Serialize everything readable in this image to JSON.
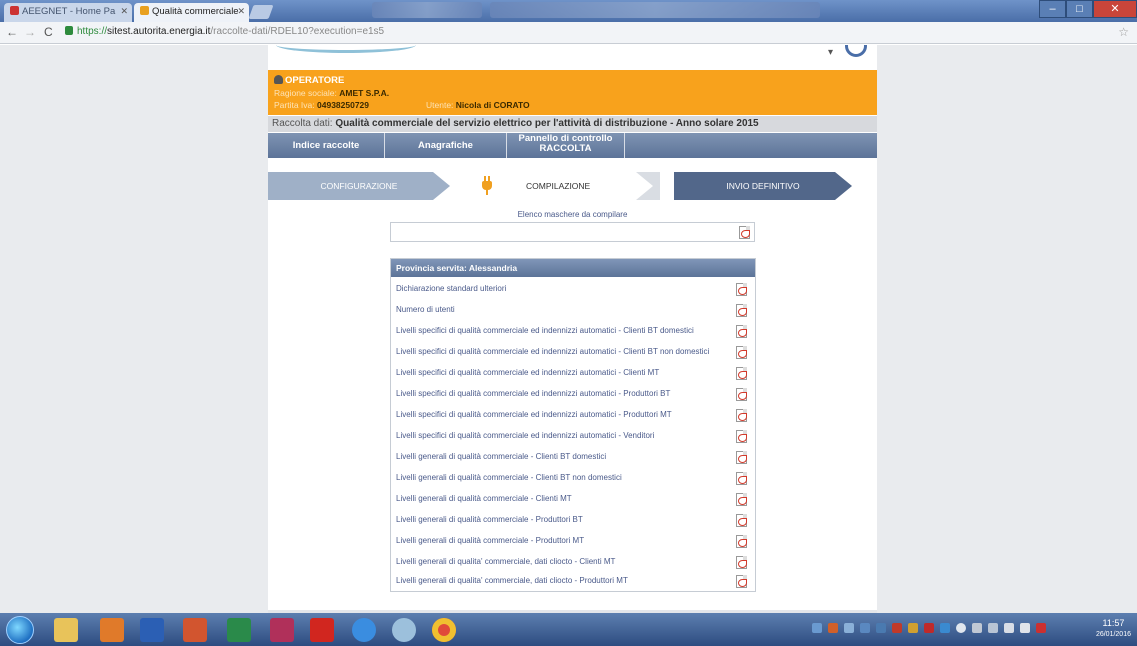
{
  "browser": {
    "tabs": [
      {
        "label": "AEEGNET - Home Pa",
        "active": false
      },
      {
        "label": "Qualità commerciale",
        "active": true
      }
    ],
    "url_scheme": "https://",
    "url_domain": "sitest.autorita.energia.it",
    "url_path": "/raccolte-dati/RDEL10?execution=e1s5"
  },
  "operator": {
    "heading": "OPERATORE",
    "ragione_label": "Ragione sociale:",
    "ragione_value": "AMET S.P.A.",
    "piva_label": "Partita Iva:",
    "piva_value": "04938250729",
    "utente_label": "Utente:",
    "utente_value": "Nicola di CORATO"
  },
  "raccolta": {
    "label": "Raccolta dati:",
    "value": "Qualità commerciale del servizio elettrico per l'attività di distribuzione - Anno solare 2015"
  },
  "nav": {
    "indice": "Indice raccolte",
    "anagrafiche": "Anagrafiche",
    "pannello_line1": "Pannello di controllo",
    "pannello_line2": "RACCOLTA"
  },
  "steps": {
    "configurazione": "CONFIGURAZIONE",
    "compilazione": "COMPILAZIONE",
    "invio": "INVIO DEFINITIVO"
  },
  "elenco_label": "Elenco maschere da compilare",
  "table": {
    "header": "Provincia servita: Alessandria",
    "rows": [
      "Dichiarazione standard ulteriori",
      "Numero di utenti",
      "Livelli specifici di qualità commerciale ed indennizzi automatici - Clienti BT domestici",
      "Livelli specifici di qualità commerciale ed indennizzi automatici - Clienti BT non domestici",
      "Livelli specifici di qualità commerciale ed indennizzi automatici - Clienti MT",
      "Livelli specifici di qualità commerciale ed indennizzi automatici - Produttori BT",
      "Livelli specifici di qualità commerciale ed indennizzi automatici - Produttori MT",
      "Livelli specifici di qualità commerciale ed indennizzi automatici - Venditori",
      "Livelli generali di qualità commerciale - Clienti BT domestici",
      "Livelli generali di qualità commerciale - Clienti BT non domestici",
      "Livelli generali di qualità commerciale - Clienti MT",
      "Livelli generali di qualità commerciale - Produttori BT",
      "Livelli generali di qualità commerciale - Produttori MT",
      "Livelli generali di qualita' commerciale, dati cliocto - Clienti MT",
      "Livelli generali di qualita' commerciale, dati cliocto - Produttori MT"
    ]
  },
  "clock": {
    "time": "11:57",
    "date": "26/01/2016"
  },
  "colors": {
    "accent_orange": "#f8a21c",
    "nav_blue": "#5c7398",
    "step_dark": "#52678a"
  }
}
